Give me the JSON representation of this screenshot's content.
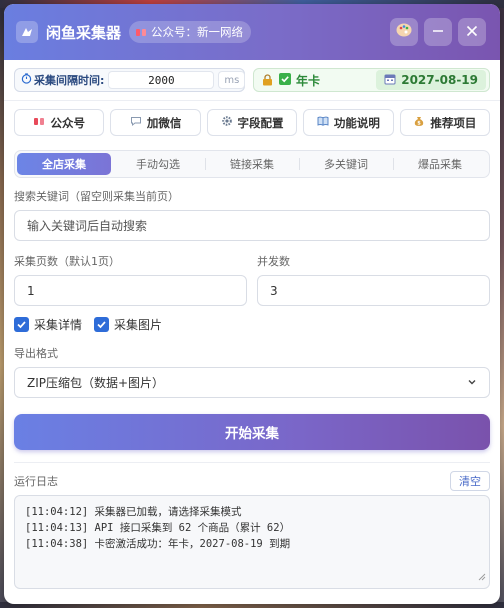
{
  "app": {
    "title": "闲鱼采集器",
    "gzh_badge": "公众号：新一网络",
    "colors": {
      "accent_start": "#6a7ee0",
      "accent_end": "#7a55b0",
      "license_green": "#2d8a3a"
    }
  },
  "window_buttons": {
    "theme": "palette-icon",
    "minimize": "minimize-icon",
    "close": "close-icon"
  },
  "interval": {
    "label": "采集间隔时间:",
    "value": "2000",
    "unit": "ms"
  },
  "license": {
    "type": "年卡",
    "expires": "2027-08-19"
  },
  "actions": [
    {
      "label": "公众号",
      "icon": "wechat-official-icon"
    },
    {
      "label": "加微信",
      "icon": "chat-bubble-icon"
    },
    {
      "label": "字段配置",
      "icon": "gear-icon"
    },
    {
      "label": "功能说明",
      "icon": "book-icon"
    },
    {
      "label": "推荐项目",
      "icon": "money-bag-icon"
    }
  ],
  "tabs": [
    {
      "label": "全店采集",
      "active": true
    },
    {
      "label": "手动勾选",
      "active": false
    },
    {
      "label": "链接采集",
      "active": false
    },
    {
      "label": "多关键词",
      "active": false
    },
    {
      "label": "爆品采集",
      "active": false
    }
  ],
  "form": {
    "keyword_label": "搜索关键词（留空则采集当前页）",
    "keyword_placeholder": "输入关键词后自动搜索",
    "pages_label": "采集页数（默认1页）",
    "pages_value": "1",
    "concurrency_label": "并发数",
    "concurrency_value": "3",
    "check_detail": "采集详情",
    "check_images": "采集图片",
    "export_label": "导出格式",
    "export_value": "ZIP压缩包（数据+图片）"
  },
  "start_button": "开始采集",
  "log": {
    "title": "运行日志",
    "clear_label": "清空",
    "lines": [
      "[11:04:12] 采集器已加载，请选择采集模式",
      "[11:04:13] API 接口采集到 62 个商品（累计 62）",
      "[11:04:38] 卡密激活成功：年卡，2027-08-19 到期"
    ]
  }
}
